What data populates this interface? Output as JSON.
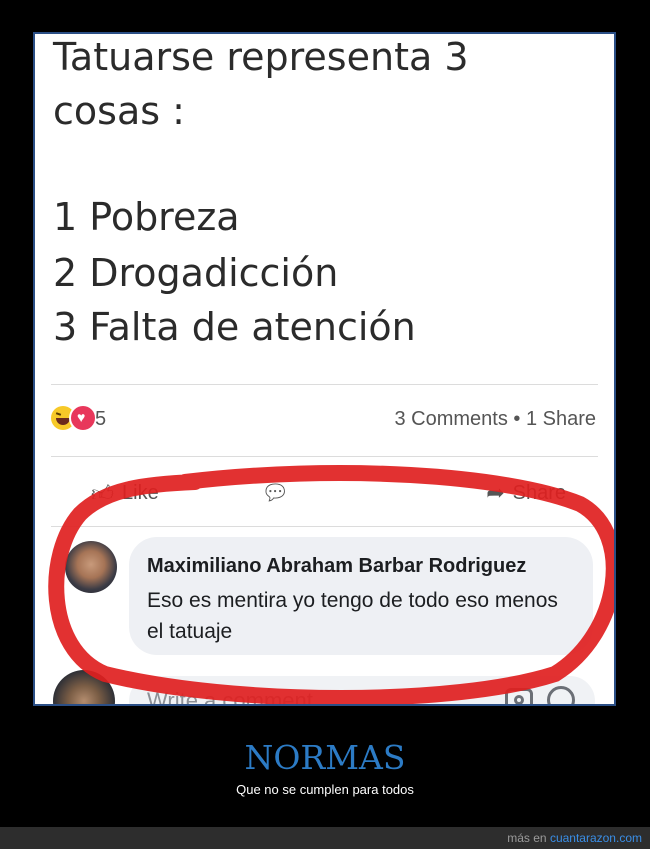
{
  "post": {
    "lines": [
      "Tatuarse representa 3",
      "cosas :",
      "1 Pobreza",
      "2 Drogadicción",
      "3 Falta de atención"
    ]
  },
  "reactions": {
    "icons": [
      "laugh-emoji-icon",
      "heart-emoji-icon"
    ],
    "count": "5",
    "stats": "3 Comments • 1 Share"
  },
  "actions": {
    "like": "Like",
    "share": "Share"
  },
  "comment": {
    "author": "Maximiliano Abraham Barbar Rodriguez",
    "text": "Eso es mentira yo tengo de todo eso menos el tatuaje"
  },
  "composer": {
    "placeholder": "Write a comment"
  },
  "caption": {
    "title": "NORMAS",
    "subtitle": "Que no se cumplen para todos"
  },
  "footer": {
    "prefix": "más en",
    "link": "cuantarazon.com"
  },
  "colors": {
    "caption_title": "#2c7bc5",
    "annotation_red": "#e02020",
    "heart": "#e8375b"
  }
}
